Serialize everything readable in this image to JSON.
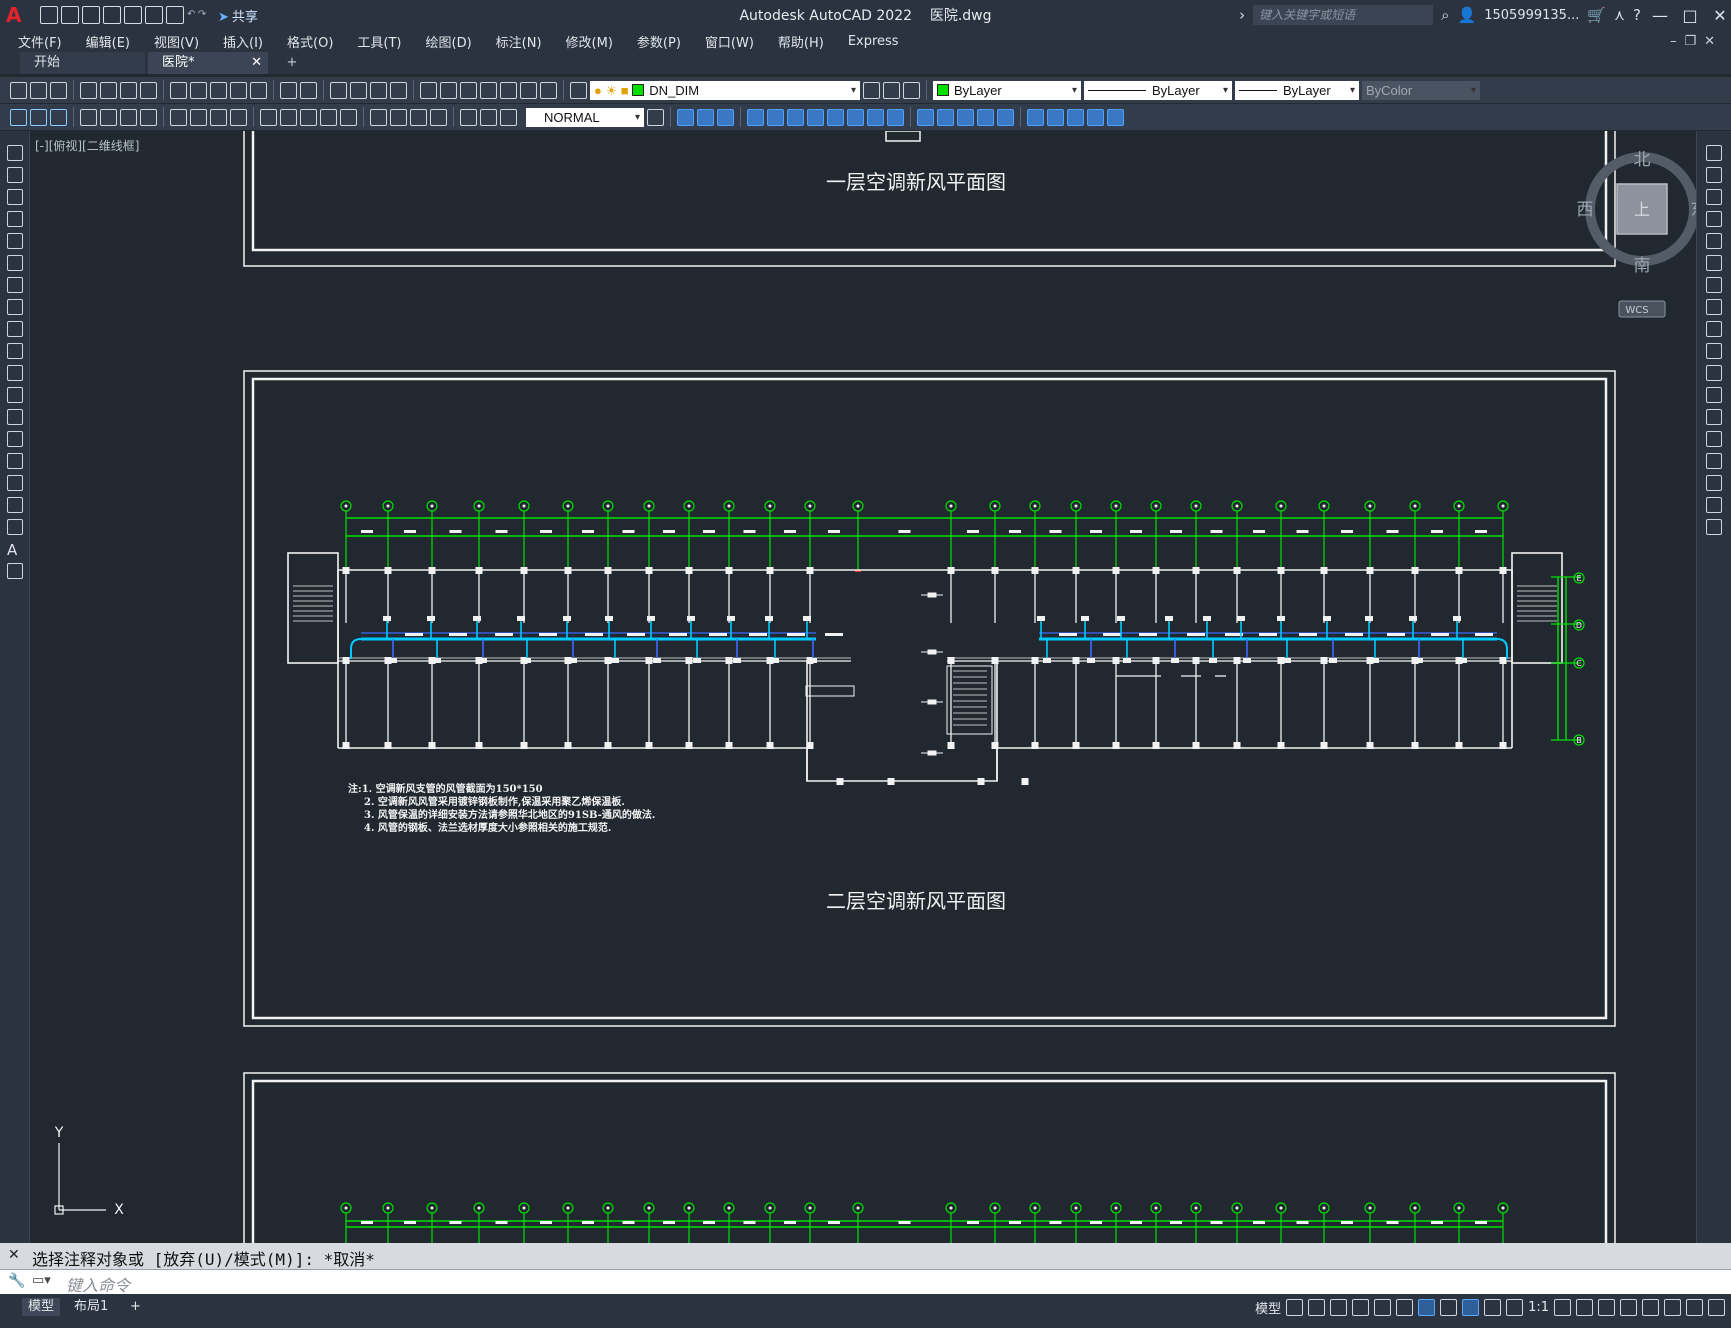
{
  "titlebar": {
    "app_title": "Autodesk AutoCAD 2022",
    "doc_name": "医院.dwg",
    "share_label": "共享",
    "search_placeholder": "键入关键字或短语",
    "user_name": "1505999135...",
    "minimize": "—",
    "maximize": "□",
    "close": "✕"
  },
  "menu": {
    "items": [
      "文件(F)",
      "编辑(E)",
      "视图(V)",
      "插入(I)",
      "格式(O)",
      "工具(T)",
      "绘图(D)",
      "标注(N)",
      "修改(M)",
      "参数(P)",
      "窗口(W)",
      "帮助(H)",
      "Express"
    ]
  },
  "tabs": {
    "start": "开始",
    "doc": "医院*",
    "close": "✕",
    "add": "+"
  },
  "toolbar": {
    "layer": "DN_DIM",
    "color": "ByLayer",
    "linetype": "ByLayer",
    "lineweight": "ByLayer",
    "plotstyle": "ByColor",
    "dimstyle": "NORMAL"
  },
  "viewport": {
    "label": "[-][俯视][二维线框]",
    "wcs": "WCS",
    "compass": {
      "north": "北",
      "south": "南",
      "east": "东",
      "west": "西",
      "top": "上"
    },
    "ucs": {
      "x": "X",
      "y": "Y"
    }
  },
  "drawing": {
    "title1": "一层空调新风平面图",
    "title2": "二层空调新风平面图",
    "notes": [
      "注:1. 空调新风支管的风管截面为150*150",
      "2. 空调新风风管采用镀锌钢板制作,保温采用聚乙烯保温板.",
      "3. 风管保温的详细安装方法请参照华北地区的91SB-通风的做法.",
      "4. 风管的钢板、法兰选材厚度大小参照相关的施工规范."
    ],
    "right_axes": [
      "E",
      "D",
      "C",
      "B"
    ]
  },
  "command": {
    "history": "选择注释对象或 [放弃(U)/模式(M)]: *取消*",
    "placeholder": "键入命令"
  },
  "status": {
    "model": "模型",
    "layout1": "布局1",
    "add": "+",
    "model_space": "模型",
    "scale": "1:1"
  },
  "colors": {
    "background": "#212830",
    "panel": "#2b3340",
    "toolbar": "#333c4a",
    "grid_green": "#00e000",
    "duct_cyan": "#00c8ff",
    "wall_white": "#f2f2f2",
    "cursor_red": "#ff3030",
    "logo_red": "#e3242b"
  }
}
